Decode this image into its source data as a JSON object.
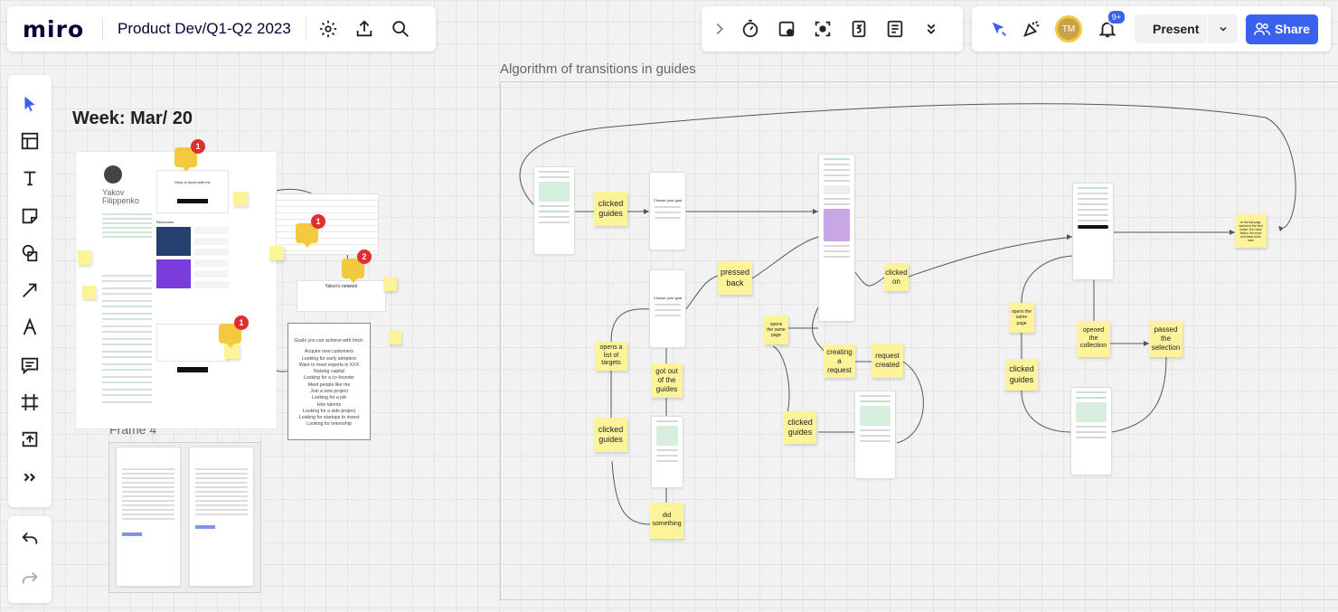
{
  "app": {
    "logo": "miro",
    "board_title": "Product Dev/Q1-Q2 2023"
  },
  "topbar_left": {
    "icons": [
      "settings-icon",
      "export-icon",
      "search-icon"
    ]
  },
  "topbar_mid": {
    "icons": [
      "expand-chevron-icon",
      "timer-icon",
      "card-icon",
      "focus-icon",
      "number-icon",
      "notes-icon",
      "more-chevrons-icon"
    ]
  },
  "topbar_right": {
    "avatar_initials": "TM",
    "notification_count": "9+",
    "present_label": "Present",
    "share_label": "Share"
  },
  "left_toolbar": {
    "tools": [
      "select-icon",
      "templates-icon",
      "text-icon",
      "sticky-note-icon",
      "shapes-icon",
      "arrow-icon",
      "pen-icon",
      "comment-icon",
      "frame-icon",
      "upload-icon",
      "more-tools-icon"
    ],
    "undo": "undo-icon",
    "redo": "redo-icon"
  },
  "board": {
    "algo_title": "Algorithm of transitions in guides",
    "week_label": "Week: Mar/ 20",
    "frame4_label": "Frame 4",
    "profile": {
      "name_line1": "Yakov",
      "name_line2": "Filippenko",
      "network_title": "Yakov's network",
      "card1_title": "Keep in touch with me",
      "card_header": "Resources"
    },
    "comment_badges": [
      "1",
      "1",
      "2",
      "1"
    ],
    "goals": {
      "title": "Goals you can achieve with Intch:",
      "items": [
        "Acquire new customers",
        "Looking for early adopters",
        "Want to meet experts in XXX",
        "Raising capital",
        "Looking for a co-founder",
        "Meet people like me",
        "Join a new project",
        "Looking for a job",
        "Hire talents",
        "Looking for a side project",
        "Looking for startups to invest",
        "Looking for internship"
      ]
    },
    "stickies": [
      "clicked guides",
      "pressed back",
      "opens a list of targets",
      "got out of the guides",
      "clicked guides",
      "did something",
      "opens the same page",
      "clicked on",
      "creating a request",
      "request created",
      "clicked guides",
      "opens the same page",
      "clicked guides",
      "opened the collection",
      "passed the selection",
      "on the last page, instead of the Next button, the Close button, the cross and leads to the main",
      "Choose your goal",
      "Choose your goal"
    ]
  }
}
